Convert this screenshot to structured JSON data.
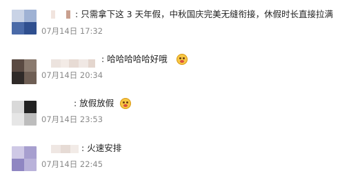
{
  "comments": [
    {
      "separator": ": ",
      "text": "只需拿下这 3 天年假，中秋国庆完美无缝衔接，休假时长直接拉满",
      "time": "07月14日 17:32",
      "emoji": null
    },
    {
      "separator": ": ",
      "text": "哈哈哈哈哈好哦",
      "time": "07月14日 20:34",
      "emoji": "laughing-face-icon"
    },
    {
      "separator": ": ",
      "text": "放假放假",
      "time": "07月14日 23:53",
      "emoji": "excited-face-icon"
    },
    {
      "separator": ": ",
      "text": "火速安排",
      "time": "07月14日 22:45",
      "emoji": null
    }
  ],
  "colors": {
    "comment_text": "#222222",
    "timestamp": "#8a8a8a",
    "background": "#ffffff"
  }
}
